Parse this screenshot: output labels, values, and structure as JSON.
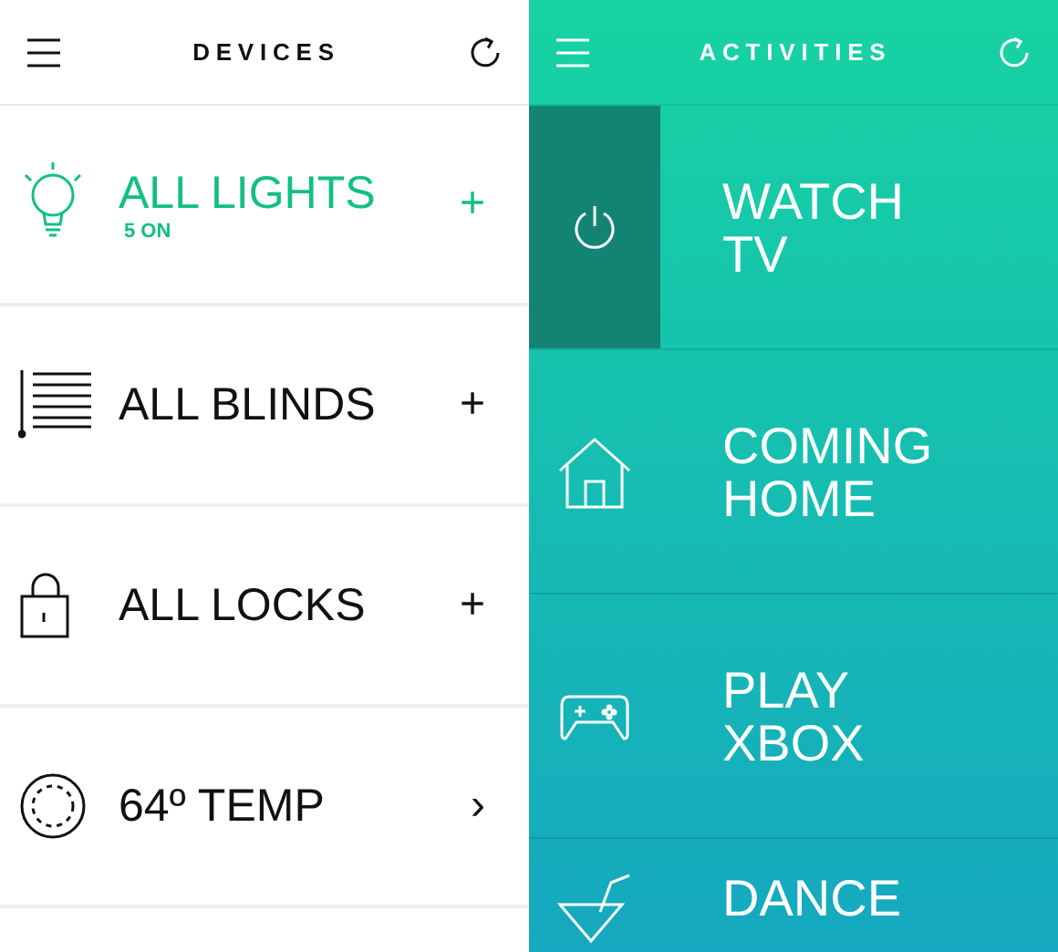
{
  "devices": {
    "title": "DEVICES",
    "items": [
      {
        "kind": "bulb",
        "label": "ALL LIGHTS",
        "status": "5 ON",
        "on": true,
        "action": "+"
      },
      {
        "kind": "blinds",
        "label": "ALL BLINDS",
        "on": false,
        "action": "+"
      },
      {
        "kind": "lock",
        "label": "ALL LOCKS",
        "on": false,
        "action": "+"
      },
      {
        "kind": "dial",
        "label": "64º TEMP",
        "on": false,
        "action": "›"
      }
    ]
  },
  "activities": {
    "title": "ACTIVITIES",
    "items": [
      {
        "kind": "power",
        "label": "WATCH TV",
        "selected": true
      },
      {
        "kind": "home",
        "label": "COMING HOME",
        "selected": false
      },
      {
        "kind": "gamepad",
        "label": "PLAY XBOX",
        "selected": false
      },
      {
        "kind": "cocktail",
        "label": "DANCE",
        "selected": false
      }
    ]
  }
}
